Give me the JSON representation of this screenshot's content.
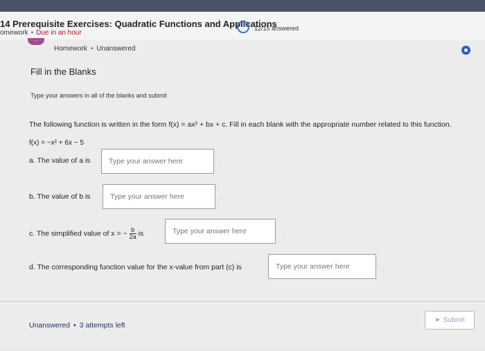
{
  "header": {
    "course_title": "14 Prerequisite Exercises: Quadratic Functions and Applications",
    "type_label": "omework",
    "due_label": "Due in an hour",
    "progress": "12/15 answered"
  },
  "card": {
    "tag_label": "...",
    "type_label": "Homework",
    "status_label": "Unanswered",
    "question_title": "Fill in the Blanks",
    "instructions": "Type your answers in all of the blanks and submit",
    "problem_text": "The following function is written in the form f(x) = ax² + bx + c. Fill in each blank with the appropriate number related to this function.",
    "function_text": "f(x) = −x² + 6x − 5",
    "parts": [
      {
        "label": "a. The value of a is",
        "placeholder": "Type your answer here"
      },
      {
        "label": "b. The value of b is",
        "placeholder": "Type your answer here"
      },
      {
        "label_prefix": "c. The simplified value of x = −",
        "frac_num": "b",
        "frac_den": "2a",
        "label_suffix": "is",
        "placeholder": "Type your answer here"
      },
      {
        "label": "d. The corresponding function value for the x-value from part (c) is",
        "placeholder": "Type your answer here"
      }
    ],
    "punct": "."
  },
  "footer": {
    "status": "Unanswered",
    "attempts": "3 attempts left",
    "submit_label": "Submit",
    "submit_icon": "paper-plane-icon"
  }
}
